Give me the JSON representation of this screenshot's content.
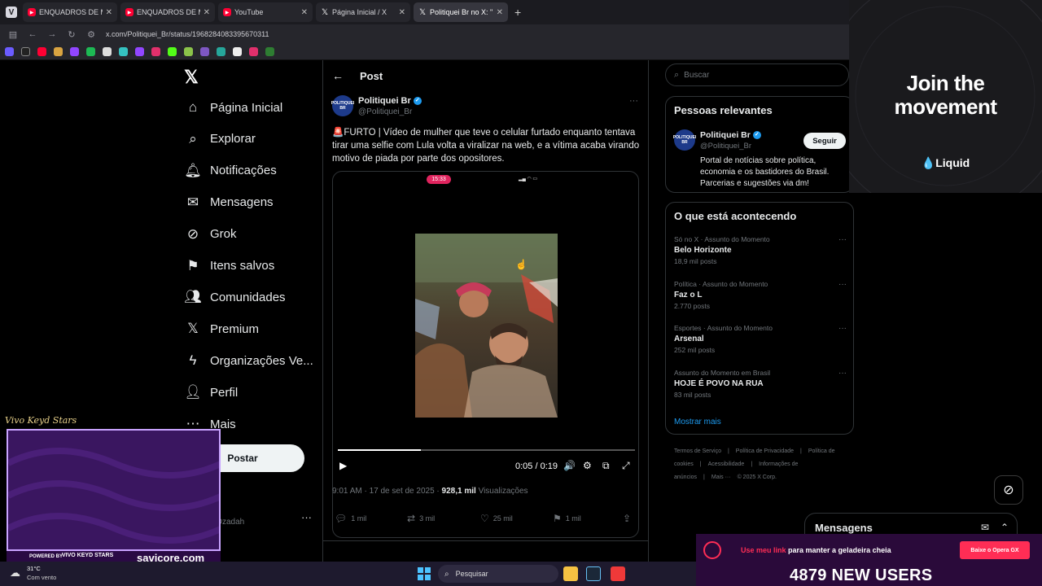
{
  "browser": {
    "tabs": [
      {
        "title": "ENQUADROS DE MOTOS",
        "favicon": "youtube-icon",
        "active": false
      },
      {
        "title": "ENQUADROS DE MOTOS",
        "favicon": "youtube-icon",
        "active": false
      },
      {
        "title": "YouTube",
        "favicon": "youtube-icon",
        "active": false
      },
      {
        "title": "Página Inicial / X",
        "favicon": "x-icon",
        "active": false
      },
      {
        "title": "Politiquei Br no X: \"🚨",
        "favicon": "x-icon",
        "active": true
      }
    ],
    "new_tab": "+",
    "url": "x.com/Politiquei_Br/status/1968284083395670311"
  },
  "nav": {
    "items": [
      {
        "label": "Página Inicial",
        "icon": "home-icon"
      },
      {
        "label": "Explorar",
        "icon": "search-icon"
      },
      {
        "label": "Notificações",
        "icon": "bell-icon"
      },
      {
        "label": "Mensagens",
        "icon": "mail-icon"
      },
      {
        "label": "Grok",
        "icon": "grok-icon"
      },
      {
        "label": "Itens salvos",
        "icon": "bookmark-icon"
      },
      {
        "label": "Comunidades",
        "icon": "people-icon"
      },
      {
        "label": "Premium",
        "icon": "x-premium-icon"
      },
      {
        "label": "Organizações Ve...",
        "icon": "lightning-icon"
      },
      {
        "label": "Perfil",
        "icon": "person-icon"
      },
      {
        "label": "Mais",
        "icon": "more-circle-icon"
      }
    ],
    "post_button": "Postar",
    "account_name": "o",
    "account_handle": "GDzadah"
  },
  "post": {
    "header_title": "Post",
    "author_name": "Politiquei Br",
    "author_handle": "@Politiquei_Br",
    "avatar_text": "POLITIQUEI BR",
    "text": "🚨FURTO | Vídeo de mulher que teve o celular furtado enquanto tentava tirar uma selfie com Lula volta a viralizar na web, e a vítima acaba virando motivo de piada por parte dos opositores.",
    "video": {
      "phone_time": "15:33",
      "elapsed": "0:05 / 0:19",
      "progress": 0.28
    },
    "timestamp": "9:01 AM · 17 de set de 2025 · ",
    "views": "928,1 mil",
    "views_label": " Visualizações",
    "actions": {
      "replies": "1 mil",
      "reposts": "3 mil",
      "likes": "25 mil",
      "bookmarks": "1 mil"
    }
  },
  "sidebar": {
    "search_placeholder": "Buscar",
    "relevant": {
      "title": "Pessoas relevantes",
      "name": "Politiquei Br",
      "handle": "@Politiquei_Br",
      "follow": "Seguir",
      "bio": "Portal de notícias sobre política, economia e os bastidores do Brasil. Parcerias e sugestões via dm!"
    },
    "trending": {
      "title": "O que está acontecendo",
      "items": [
        {
          "meta": "Só no X · Assunto do Momento",
          "name": "Belo Horizonte",
          "count": "18,9 mil posts"
        },
        {
          "meta": "Política · Assunto do Momento",
          "name": "Faz o L",
          "count": "2.770 posts"
        },
        {
          "meta": "Esportes · Assunto do Momento",
          "name": "Arsenal",
          "count": "252 mil posts"
        },
        {
          "meta": "Assunto do Momento em Brasil",
          "name": "HOJE É POVO NA RUA",
          "count": "83 mil posts"
        }
      ],
      "show_more": "Mostrar mais"
    },
    "footer": [
      "Termos de Serviço",
      "|",
      "Política de Privacidade",
      "|",
      "Política de cookies",
      "|",
      "Acessibilidade",
      "|",
      "Informações de anúncios",
      "|",
      "Mais ···",
      "© 2025 X Corp."
    ]
  },
  "ad": {
    "title_line1": "Join the",
    "title_line2": "movement",
    "brand": "💧Liquid"
  },
  "messages": {
    "title": "Mensagens"
  },
  "stream": {
    "banner_pink": "Use meu link",
    "banner_rest": " para manter a geladeira cheia",
    "cta": "Baixe o Opera GX",
    "users": "4879 NEW USERS",
    "signature": "Vivo Keyd Stars",
    "powered_by": "POWERED BY",
    "powered_logo": "VIVO KEYD STARS",
    "site": "savicore.com"
  },
  "taskbar": {
    "temp": "31°C",
    "weather": "Com vento",
    "search": "Pesquisar"
  },
  "colors": {
    "accent": "#1d9bf0",
    "background": "#000000",
    "stream_pink": "#ff2d55"
  }
}
